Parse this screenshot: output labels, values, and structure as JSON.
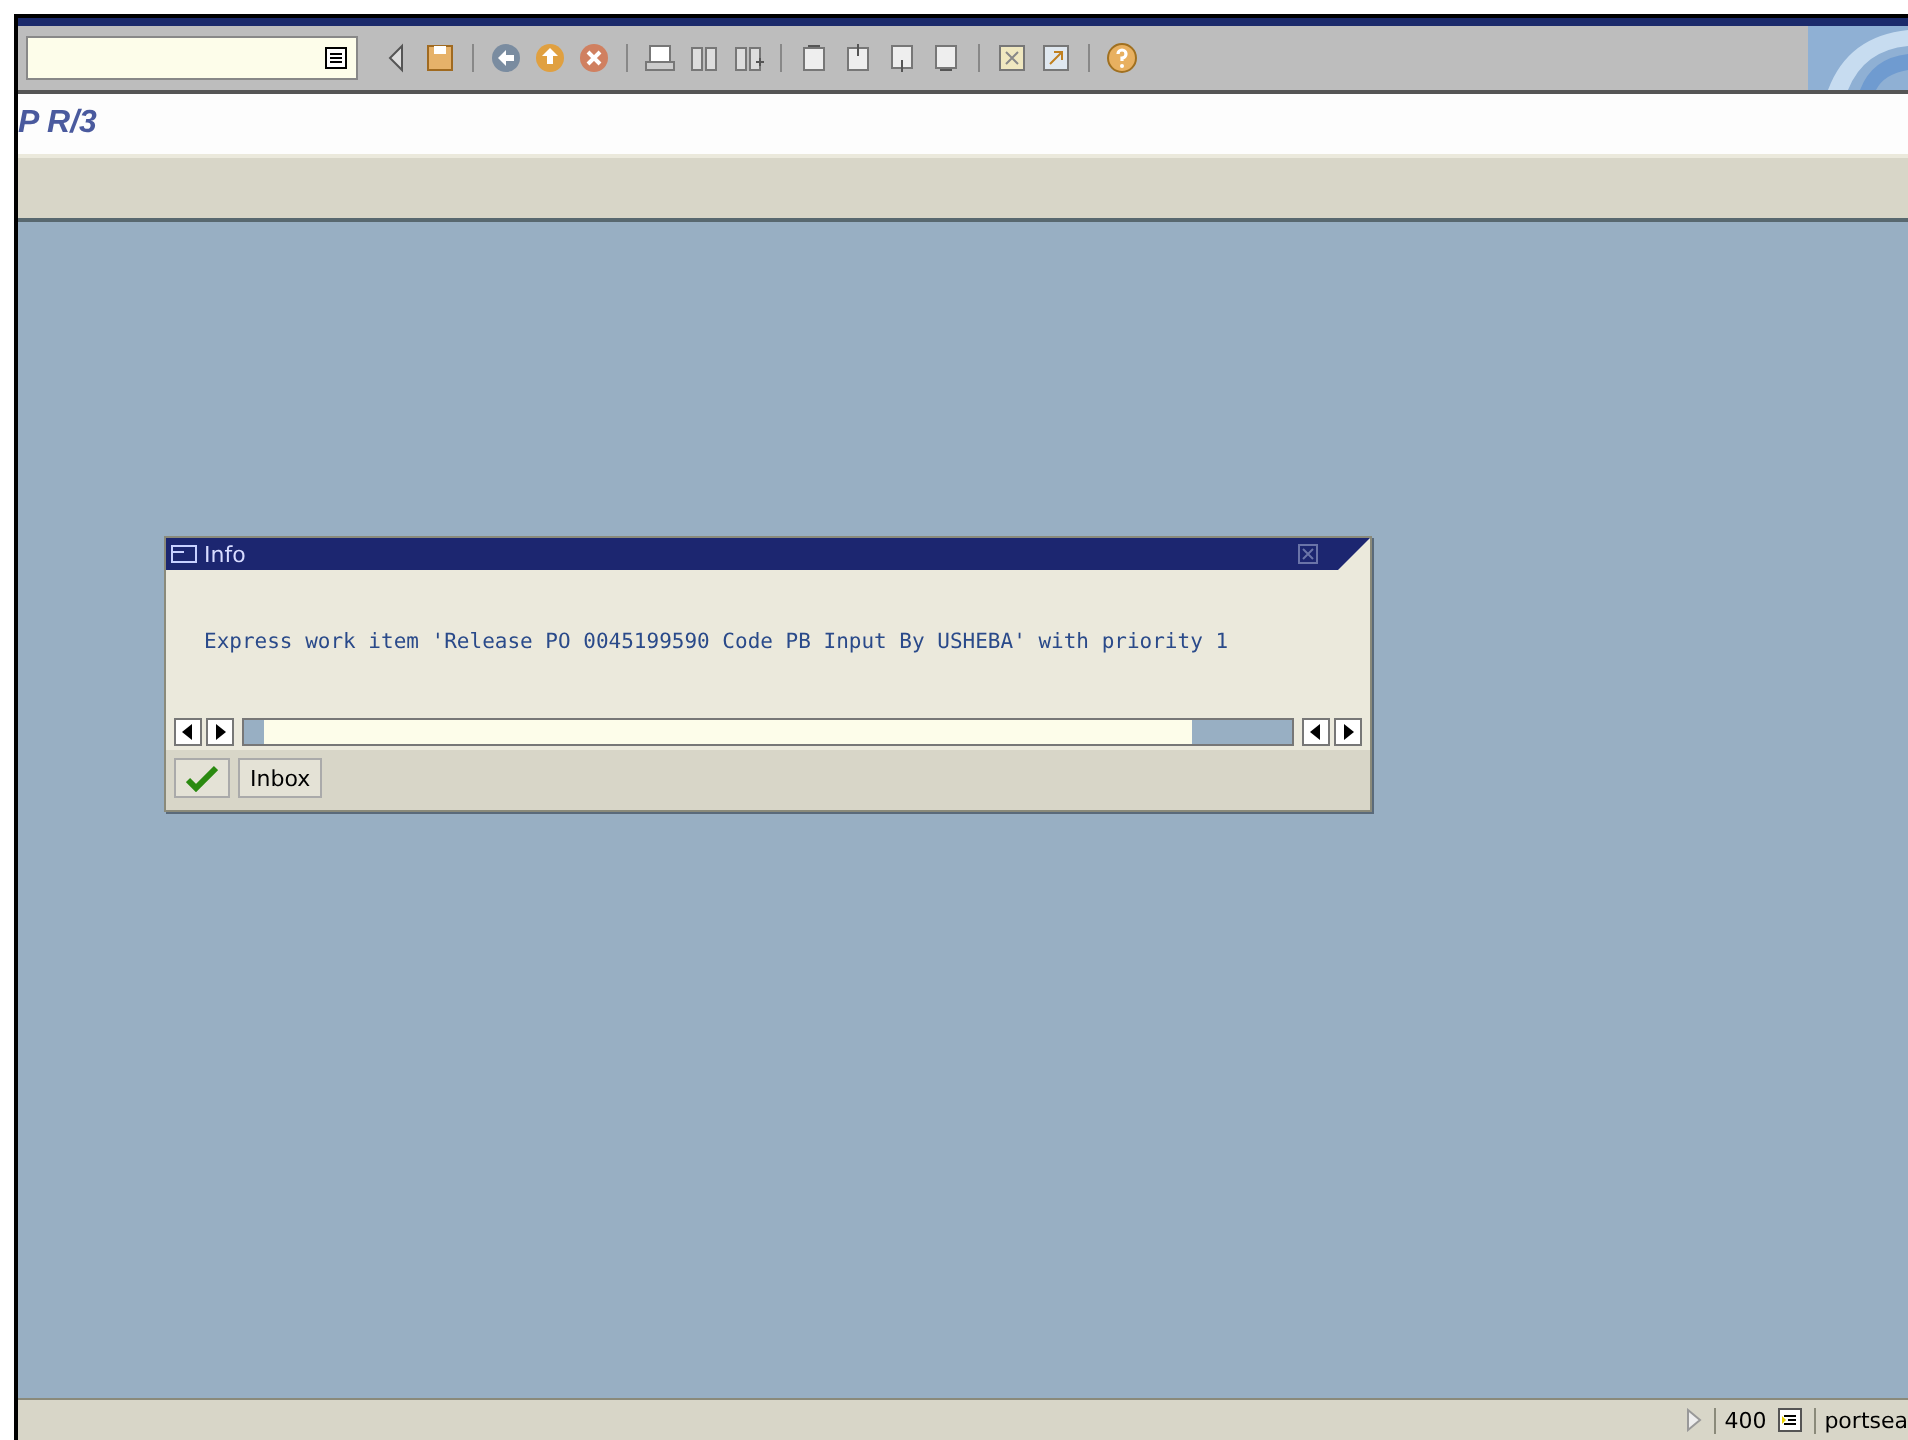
{
  "window": {
    "title": "P R/3"
  },
  "dialog": {
    "title": "Info",
    "message": "Express work item 'Release PO 0045199590 Code PB Input By USHEBA' with priority 1",
    "buttons": [
      {
        "kind": "icon"
      },
      {
        "kind": "text",
        "label": "Inbox"
      }
    ]
  },
  "status_bar": {
    "client": "400",
    "server": "portsea"
  }
}
